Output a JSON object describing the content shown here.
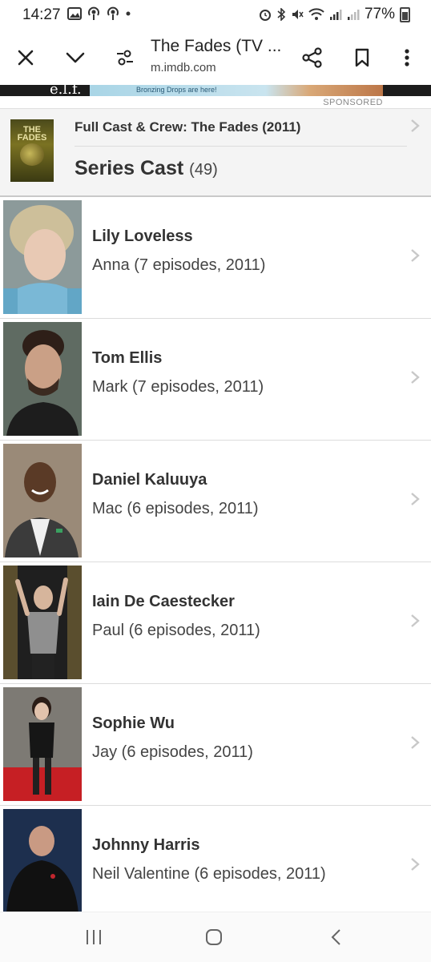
{
  "status_bar": {
    "time": "14:27",
    "battery": "77%"
  },
  "toolbar": {
    "title": "The Fades (TV ...",
    "url": "m.imdb.com",
    "icons": [
      "close-icon",
      "chevron-down-icon",
      "page-settings-icon",
      "share-icon",
      "bookmark-icon",
      "more-vert-icon"
    ]
  },
  "ad": {
    "logo": "e.l.f.",
    "text": "Bronzing Drops are here!",
    "sponsored_label": "SPONSORED"
  },
  "header": {
    "crumb": "Full Cast & Crew: The Fades (2011)",
    "title": "Series Cast",
    "count": "(49)",
    "poster_title": "THE FADES"
  },
  "cast": [
    {
      "name": "Lily Loveless",
      "role": "Anna (7 episodes, 2011)"
    },
    {
      "name": "Tom Ellis",
      "role": "Mark (7 episodes, 2011)"
    },
    {
      "name": "Daniel Kaluuya",
      "role": "Mac (6 episodes, 2011)"
    },
    {
      "name": "Iain De Caestecker",
      "role": "Paul (6 episodes, 2011)"
    },
    {
      "name": "Sophie Wu",
      "role": "Jay (6 episodes, 2011)"
    },
    {
      "name": "Johnny Harris",
      "role": "Neil Valentine (6 episodes, 2011)"
    }
  ],
  "nav": {
    "icons": [
      "recents-icon",
      "home-icon",
      "back-icon"
    ]
  },
  "colors": {
    "header_bg": "#f4f4f4",
    "divider": "#dcdcdc",
    "text": "#333333"
  }
}
